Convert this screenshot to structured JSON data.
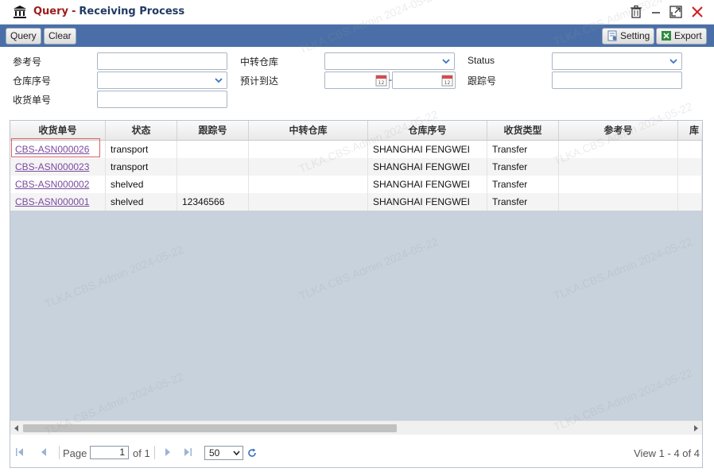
{
  "window": {
    "title_query": "Query",
    "title_sep": "-",
    "title_process": "Receiving Process"
  },
  "toolbar": {
    "query_label": "Query",
    "clear_label": "Clear",
    "setting_label": "Setting",
    "export_label": "Export"
  },
  "form": {
    "ref_no_label": "参考号",
    "transit_wh_label": "中转仓库",
    "status_label": "Status",
    "wh_no_label": "仓库序号",
    "eta_label": "预计到达",
    "eta_sep": "-",
    "tracking_label": "跟踪号",
    "receipt_no_label": "收货单号"
  },
  "grid": {
    "columns": [
      "收货单号",
      "状态",
      "跟踪号",
      "中转仓库",
      "仓库序号",
      "收货类型",
      "参考号",
      "库"
    ],
    "rows": [
      [
        "CBS-ASN000026",
        "transport",
        "",
        "",
        "SHANGHAI FENGWEI",
        "Transfer",
        "",
        ""
      ],
      [
        "CBS-ASN000023",
        "transport",
        "",
        "",
        "SHANGHAI FENGWEI",
        "Transfer",
        "",
        ""
      ],
      [
        "CBS-ASN000002",
        "shelved",
        "",
        "",
        "SHANGHAI FENGWEI",
        "Transfer",
        "",
        ""
      ],
      [
        "CBS-ASN000001",
        "shelved",
        "12346566",
        "",
        "SHANGHAI FENGWEI",
        "Transfer",
        "",
        ""
      ]
    ]
  },
  "pager": {
    "page_label": "Page",
    "page_value": "1",
    "of_label": "of 1",
    "page_size": "50",
    "view_text": "View 1 - 4 of 4"
  },
  "watermark": {
    "text": "TLKA.CBS.Admin 2024-05-22"
  },
  "colors": {
    "toolbar_bg": "#4a6fa8",
    "title_query": "#9b1c1c",
    "title_process": "#1f3a63",
    "link": "#7a4aa0",
    "grid_empty_bg": "#c8d2dc"
  },
  "icons": {
    "app": "bank-icon",
    "delete": "trash-icon",
    "minimize": "minimize-icon",
    "maximize": "maximize-icon",
    "close": "close-icon",
    "setting": "setting-icon",
    "export": "excel-icon",
    "calendar": "calendar-icon",
    "refresh": "refresh-icon"
  }
}
